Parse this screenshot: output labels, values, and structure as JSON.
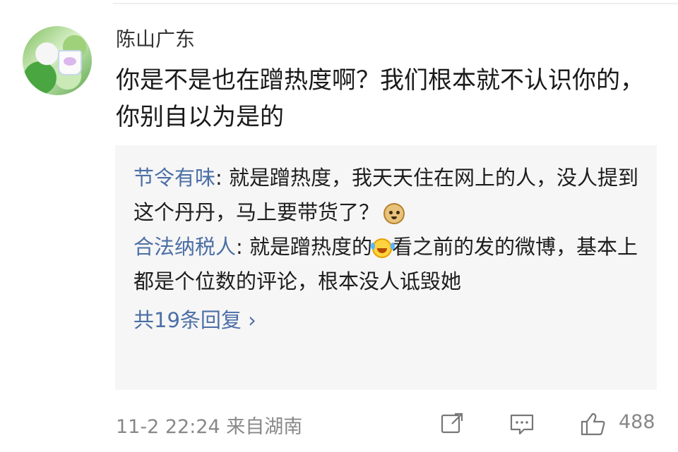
{
  "comment": {
    "username": "陈山广东",
    "text": "你是不是也在蹭热度啊？我们根本就不认识你的，你别自以为是的"
  },
  "replies": [
    {
      "user": "节令有味",
      "text_before_emoji": ": 就是蹭热度，我天天住在网上的人，没人提到这个丹丹，马上要带货了？",
      "text_after_emoji": "",
      "emoji": "doge-icon"
    },
    {
      "user": "合法纳税人",
      "text_before_emoji": ": 就是蹭热度的",
      "text_after_emoji": "看之前的发的微博，基本上都是个位数的评论，根本没人诋毁她",
      "emoji": "laugh-cry-icon"
    }
  ],
  "more_replies": "共19条回复 ›",
  "footer": {
    "meta": "11-2 22:24  来自湖南",
    "like_count": "488",
    "icons": [
      "share-icon",
      "comment-icon",
      "like-icon"
    ]
  },
  "colors": {
    "username_link": "#4c6fa6",
    "meta_text": "#888888",
    "reply_bg": "#f6f6f6"
  }
}
